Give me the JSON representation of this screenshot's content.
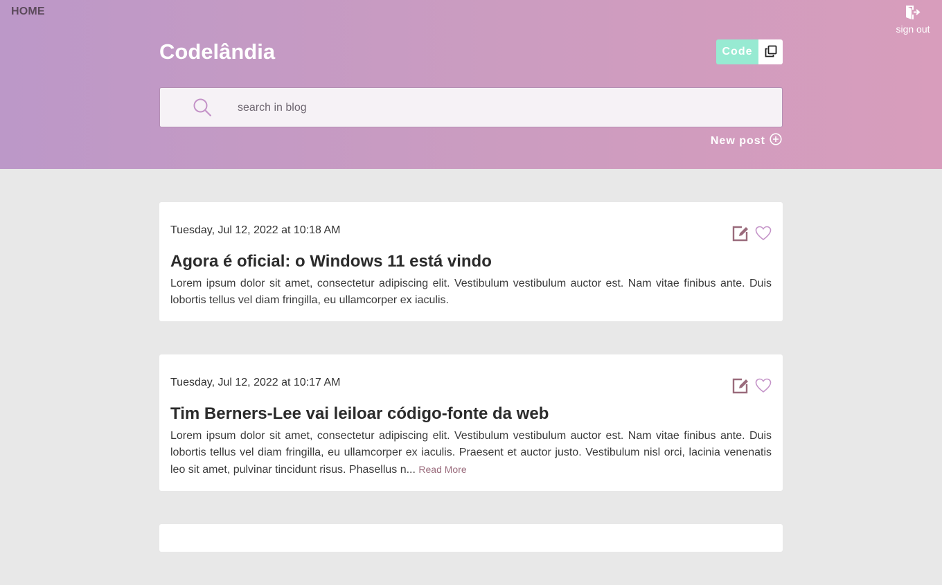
{
  "nav": {
    "home_label": "HOME",
    "signout_label": "sign out",
    "signout_icon": "exit-door-icon"
  },
  "header": {
    "brand": "Codelândia",
    "code_toggle_label": "Code",
    "copy_icon": "copy-icon",
    "search_placeholder": "search in blog",
    "search_value": "",
    "search_icon": "search-icon",
    "new_post_label": "New post",
    "new_post_icon": "plus-circle-icon"
  },
  "colors": {
    "header_gradient_start": "#bc98c8",
    "header_gradient_end": "#d89dbc",
    "code_toggle": "#97ead2",
    "page_background": "#e8e8e8",
    "accent_icon": "#9a6b7c",
    "heart_icon": "#c493c8"
  },
  "posts": [
    {
      "date": "Tuesday, Jul 12, 2022 at 10:18 AM",
      "title": "Agora é oficial: o Windows 11 está vindo",
      "body": "Lorem ipsum dolor sit amet, consectetur adipiscing elit. Vestibulum vestibulum auctor est. Nam vitae finibus ante. Duis lobortis tellus vel diam fringilla, eu ullamcorper ex iaculis.",
      "read_more": "",
      "edit_icon": "edit-icon",
      "like_icon": "heart-icon"
    },
    {
      "date": "Tuesday, Jul 12, 2022 at 10:17 AM",
      "title": "Tim Berners-Lee vai leiloar código-fonte da web",
      "body": "Lorem ipsum dolor sit amet, consectetur adipiscing elit. Vestibulum vestibulum auctor est. Nam vitae finibus ante. Duis lobortis tellus vel diam fringilla, eu ullamcorper ex iaculis. Praesent et auctor justo. Vestibulum nisl orci, lacinia venenatis leo sit amet, pulvinar tincidunt risus. Phasellus n...",
      "read_more": "Read More",
      "edit_icon": "edit-icon",
      "like_icon": "heart-icon"
    }
  ]
}
